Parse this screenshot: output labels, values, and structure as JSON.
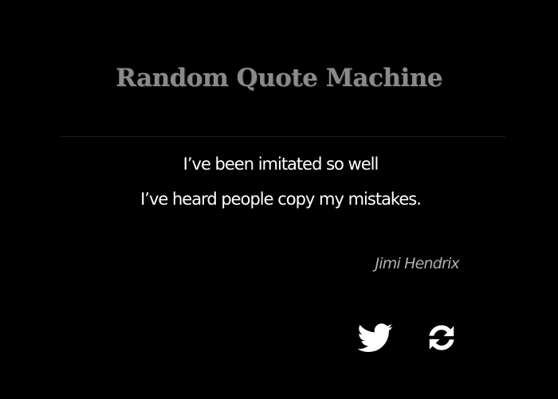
{
  "header": {
    "title": "Random Quote Machine"
  },
  "quote": {
    "lines": [
      "I’ve been imitated so well",
      "I’ve heard people copy my  mistakes."
    ],
    "author": "Jimi Hendrix"
  },
  "actions": {
    "tweet_icon": "twitter-icon",
    "refresh_icon": "refresh-icon"
  },
  "colors": {
    "background": "#000000",
    "title": "#8a8a8a",
    "quote_text": "#ffffff",
    "author_text": "#b0b0b0",
    "icons": "#ffffff"
  }
}
